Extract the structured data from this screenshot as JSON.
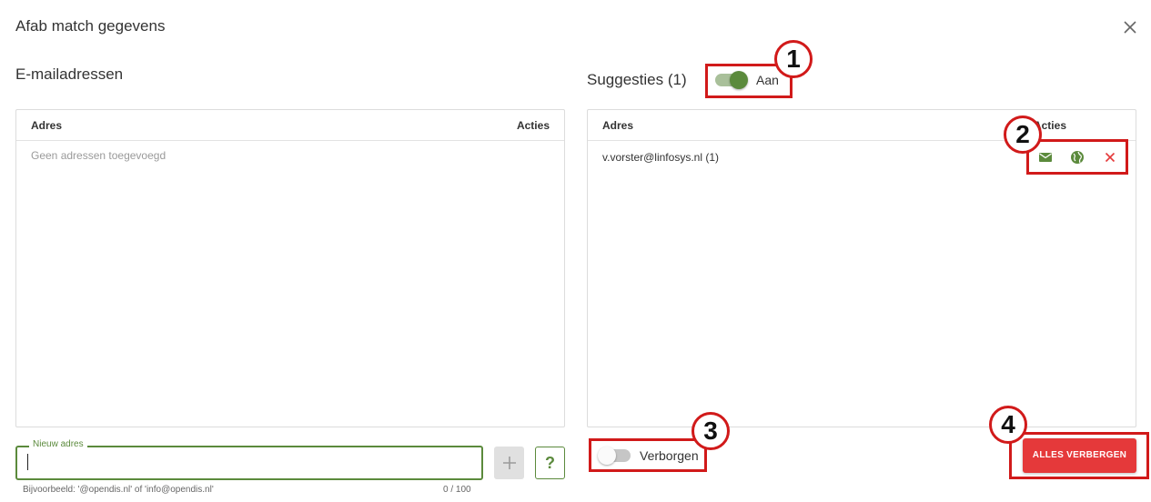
{
  "dialog": {
    "title": "Afab match gegevens",
    "close_icon": "close-icon"
  },
  "emails": {
    "heading": "E-mailadressen",
    "col_address": "Adres",
    "col_actions": "Acties",
    "empty_text": "Geen adressen toegevoegd",
    "new_input": {
      "label": "Nieuw adres",
      "value": "",
      "hint": "Bijvoorbeeld: '@opendis.nl' of 'info@opendis.nl'",
      "counter": "0 / 100"
    },
    "add_button_icon": "plus-icon",
    "help_button_label": "?"
  },
  "suggestions": {
    "heading": "Suggesties (1)",
    "toggle_label": "Aan",
    "toggle_on": true,
    "col_address": "Adres",
    "col_actions": "Acties",
    "rows": [
      {
        "address": "v.vorster@linfosys.nl (1)",
        "actions": [
          "mail-icon",
          "globe-icon",
          "close-icon"
        ]
      }
    ],
    "hidden_toggle_label": "Verborgen",
    "hidden_toggle_on": false,
    "hide_all_button": "ALLES VERBERGEN"
  },
  "annotations": [
    "1",
    "2",
    "3",
    "4"
  ],
  "colors": {
    "primary_green": "#5b8a3c",
    "danger_red": "#e5393a",
    "annotation_red": "#d11a1a"
  }
}
